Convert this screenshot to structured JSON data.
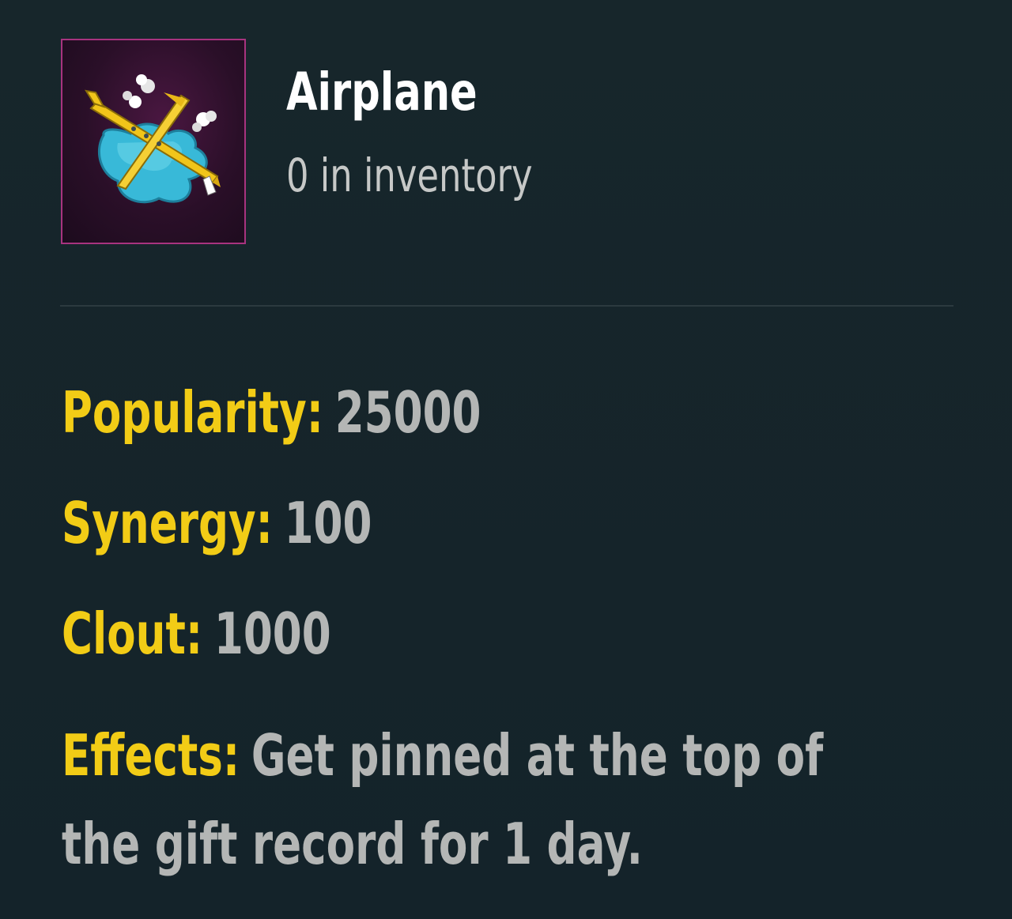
{
  "item": {
    "title": "Airplane",
    "inventory_text": "0 in inventory",
    "icon": "airplane-gift-icon",
    "frame_color": "#a8337f"
  },
  "stats": {
    "popularity": {
      "label": "Popularity:",
      "value": "25000"
    },
    "synergy": {
      "label": "Synergy:",
      "value": "100"
    },
    "clout": {
      "label": "Clout:",
      "value": "1000"
    },
    "effects": {
      "label": "Effects:",
      "value": "Get pinned at the top of the gift record for 1 day."
    }
  },
  "colors": {
    "background": "#16252a",
    "label": "#f2cc16",
    "value": "#b4b6b5",
    "title": "#ffffff"
  }
}
